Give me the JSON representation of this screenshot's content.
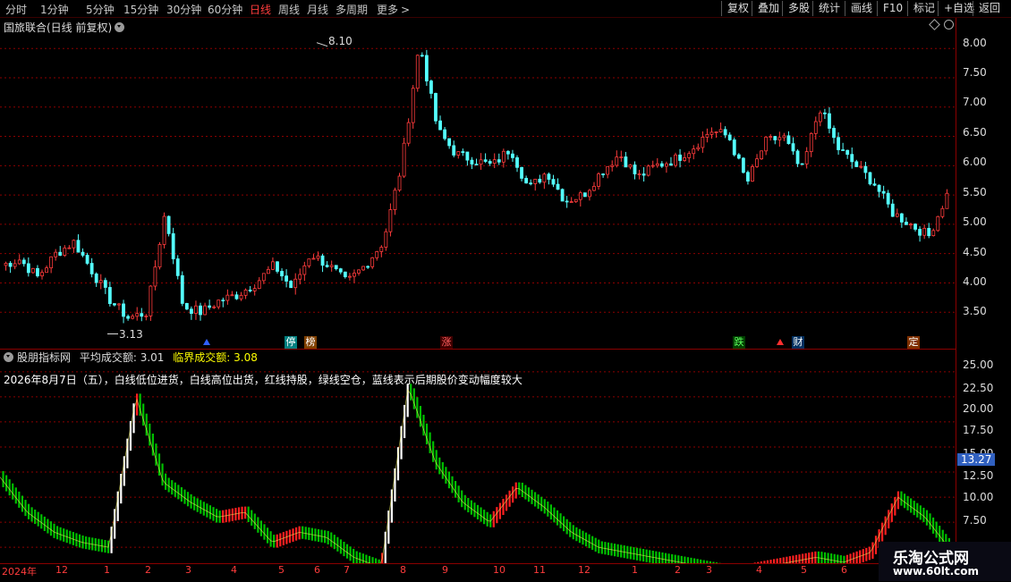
{
  "toolbar": {
    "periods": [
      "分时",
      "1分钟",
      "5分钟",
      "15分钟",
      "30分钟",
      "60分钟",
      "日线",
      "周线",
      "月线",
      "多周期",
      "更多"
    ],
    "more_arrow": ">",
    "active_period": "日线",
    "buttons": [
      "复权",
      "叠加",
      "多股",
      "统计",
      "画线",
      "F10",
      "标记",
      "+自选",
      "返回"
    ]
  },
  "main_chart": {
    "title": "国旅联合(日线 前复权)",
    "high_label": "8.10",
    "low_label": "3.13",
    "y_ticks": [
      "8.00",
      "7.50",
      "7.00",
      "6.50",
      "6.00",
      "5.50",
      "5.00",
      "4.50",
      "4.00",
      "3.50"
    ],
    "badges": [
      "停",
      "榜",
      "涨",
      "跌",
      "财",
      "定"
    ]
  },
  "indicator": {
    "name": "股朋指标网",
    "avg_label": "平均成交额:",
    "avg_value": "3.01",
    "critical_label": "临界成交额:",
    "critical_value": "3.08",
    "description": "2026年8月7日（五），白线低位进货，白线高位出货，红线持股，绿线空仓，蓝线表示后期股价变动幅度较大",
    "y_ticks": [
      "25.00",
      "22.50",
      "20.00",
      "17.50",
      "15.00",
      "12.50",
      "10.00",
      "7.50"
    ],
    "current_value": "13.27"
  },
  "date_axis": [
    "2024年",
    "12",
    "1",
    "2",
    "3",
    "4",
    "5",
    "6",
    "7",
    "8",
    "9",
    "10",
    "11",
    "12",
    "1",
    "2",
    "3",
    "4",
    "5",
    "6"
  ],
  "chart_data": [
    {
      "type": "candlestick",
      "title": "国旅联合(日线 前复权)",
      "ylim": [
        3.0,
        8.4
      ],
      "annotations": [
        {
          "label": "8.10",
          "value": 8.1
        },
        {
          "label": "3.13",
          "value": 3.13
        }
      ],
      "close_path": [
        4.3,
        4.4,
        4.1,
        4.5,
        4.7,
        4.2,
        3.7,
        3.4,
        3.5,
        5.2,
        3.6,
        3.5,
        3.7,
        3.8,
        4.0,
        4.3,
        3.9,
        4.5,
        4.3,
        4.0,
        4.3,
        4.7,
        6.0,
        8.1,
        6.6,
        6.2,
        6.1,
        6.0,
        6.3,
        5.6,
        5.9,
        5.4,
        5.5,
        5.9,
        6.2,
        5.8,
        6.0,
        6.1,
        6.3,
        6.6,
        6.5,
        5.7,
        6.4,
        6.5,
        5.9,
        7.0,
        6.3,
        6.0,
        5.7,
        5.2,
        5.0,
        4.8,
        5.5
      ]
    },
    {
      "type": "line",
      "title": "股朋指标网",
      "ylim": [
        6.0,
        26.5
      ],
      "close_path": [
        14.5,
        11.0,
        9.0,
        8.0,
        7.5,
        22.5,
        14.0,
        12.0,
        10.5,
        11.0,
        8.0,
        9.0,
        8.5,
        6.5,
        5.5,
        23.5,
        16.0,
        12.0,
        10.0,
        13.5,
        11.5,
        9.0,
        7.5,
        7.0,
        6.5,
        6.0,
        5.5,
        5.0,
        5.5,
        6.0,
        6.5,
        6.0,
        7.0,
        12.5,
        10.5,
        7.0
      ]
    }
  ],
  "watermark": {
    "title": "乐淘公式网",
    "url": "www.60lt.com"
  }
}
